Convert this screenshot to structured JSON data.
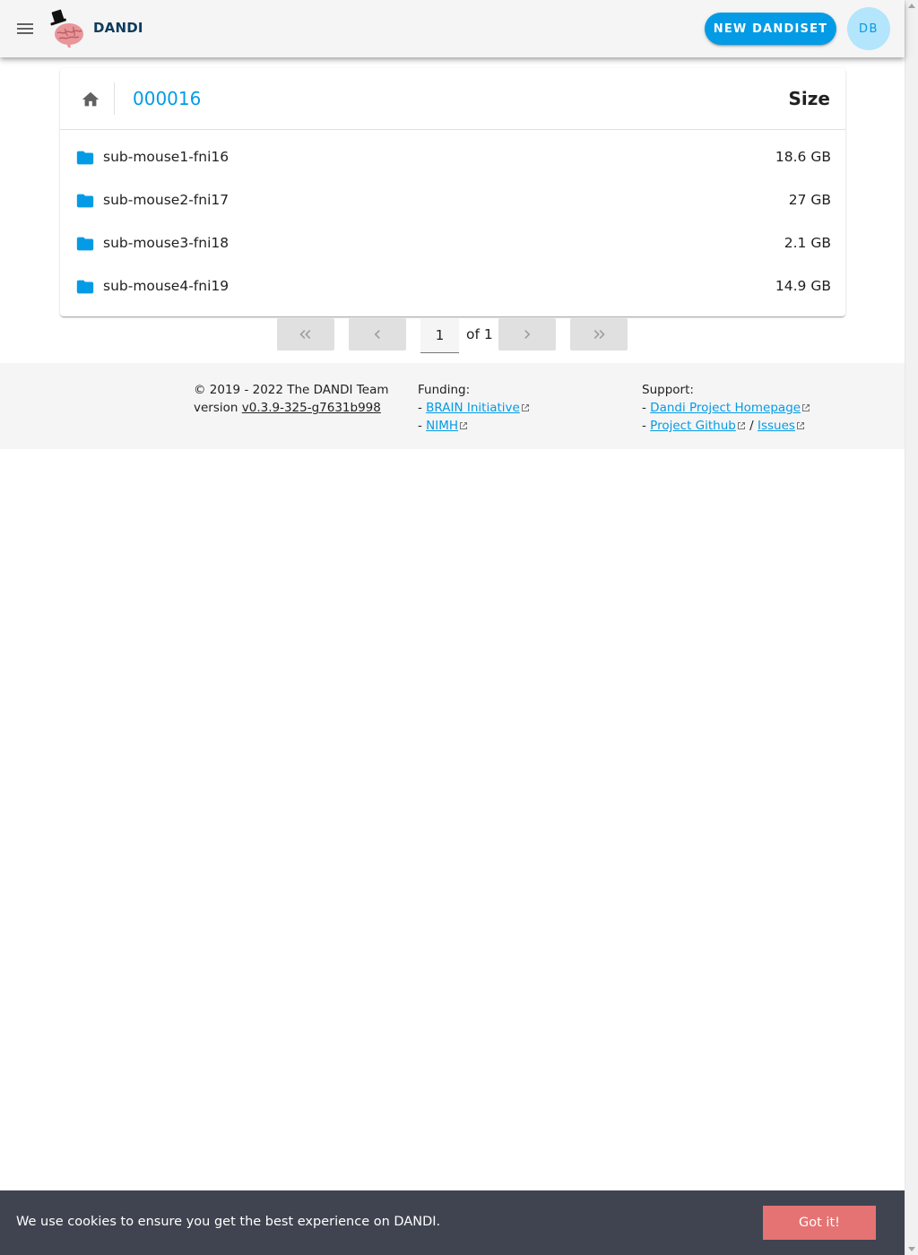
{
  "header": {
    "brand": "DANDI",
    "new_dandiset_label": "NEW DANDISET",
    "avatar_initials": "DB",
    "icons": {
      "menu": "menu-icon",
      "logo": "dandi-brain-logo"
    }
  },
  "file_browser": {
    "breadcrumb": "000016",
    "size_header": "Size",
    "rows": [
      {
        "name": "sub-mouse1-fni16",
        "size": "18.6 GB",
        "icon": "folder-icon"
      },
      {
        "name": "sub-mouse2-fni17",
        "size": "27 GB",
        "icon": "folder-icon"
      },
      {
        "name": "sub-mouse3-fni18",
        "size": "2.1 GB",
        "icon": "folder-icon"
      },
      {
        "name": "sub-mouse4-fni19",
        "size": "14.9 GB",
        "icon": "folder-icon"
      }
    ]
  },
  "pagination": {
    "current_page": "1",
    "of_label": "of 1"
  },
  "footer": {
    "copyright": "© 2019 - 2022 The DANDI Team",
    "version_prefix": "version ",
    "version": "v0.3.9-325-g7631b998",
    "funding_label": "Funding:",
    "funding_links": [
      "BRAIN Initiative",
      "NIMH"
    ],
    "support_label": "Support:",
    "support_homepage": "Dandi Project Homepage",
    "support_github": "Project Github",
    "support_separator": "/",
    "support_issues": "Issues",
    "bullet": "-"
  },
  "cookie_banner": {
    "message": "We use cookies to ensure you get the best experience on DANDI.",
    "button": "Got it!"
  },
  "colors": {
    "accent": "#039be5",
    "appbar_bg": "#f5f5f5",
    "cookie_bg": "#3f4450",
    "cookie_button": "#e57373"
  }
}
